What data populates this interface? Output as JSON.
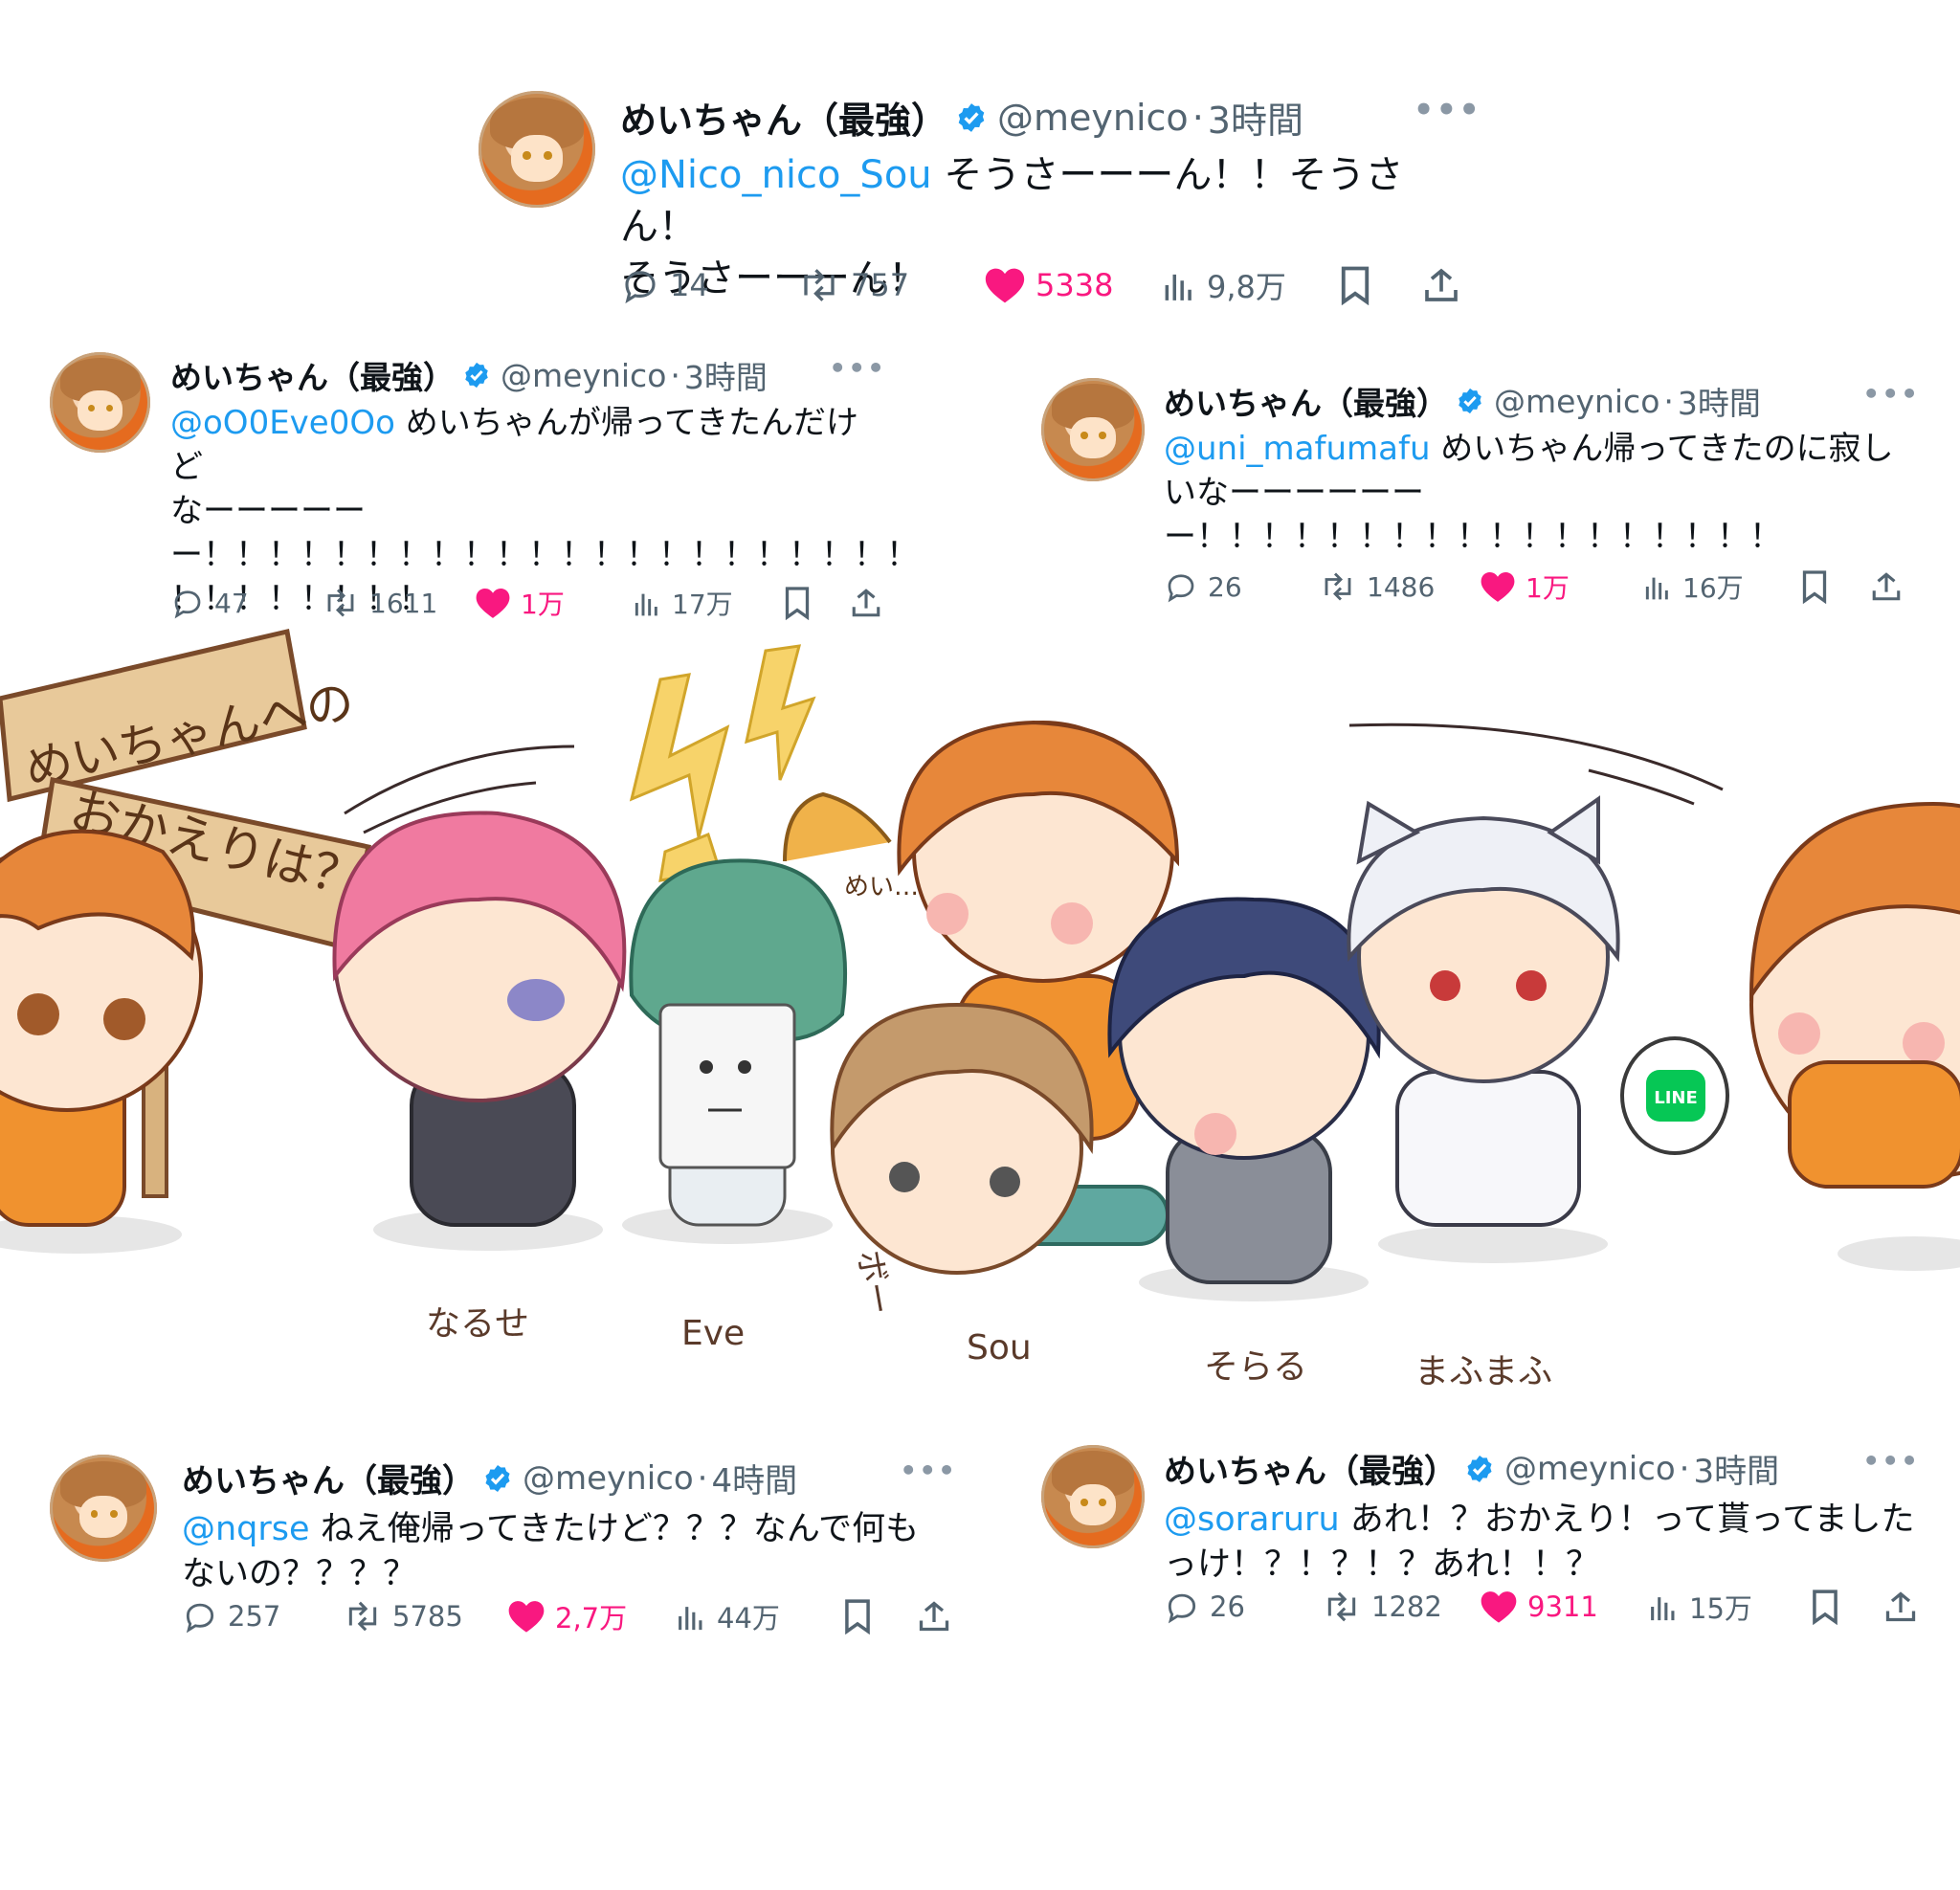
{
  "colors": {
    "link": "#1d9bf0",
    "like": "#f91880",
    "muted": "#536471",
    "verified": "#1d9bf0"
  },
  "tweets": [
    {
      "name": "めいちゃん（最強）",
      "handle": "@meynico",
      "separator": "·",
      "time": "3時間",
      "mention": "@Nico_nico_Sou",
      "text": " そうさーーーん！！そうさん！\nそうさーーーん！",
      "replies": "14",
      "retweets": "757",
      "likes": "5338",
      "views": "9,8万"
    },
    {
      "name": "めいちゃん（最強）",
      "handle": "@meynico",
      "separator": "·",
      "time": "3時間",
      "mention": "@oO0Eve0Oo",
      "text": " めいちゃんが帰ってきたんだけど\nなーーーーー\nー！！！！！！！！！！！！！！！！！！！！！！\n！！！！！！！！",
      "replies": "47",
      "retweets": "1611",
      "likes": "1万",
      "views": "17万"
    },
    {
      "name": "めいちゃん（最強）",
      "handle": "@meynico",
      "separator": "·",
      "time": "3時間",
      "mention": "@uni_mafumafu",
      "text": " めいちゃん帰ってきたのに寂し\nいなーーーーーー\nー！！！！！！！！！！！！！！！！！！",
      "replies": "26",
      "retweets": "1486",
      "likes": "1万",
      "views": "16万"
    },
    {
      "name": "めいちゃん（最強）",
      "handle": "@meynico",
      "separator": "·",
      "time": "4時間",
      "mention": "@nqrse",
      "text": " ねえ俺帰ってきたけど？？？なんで何も\nないの？？？？",
      "replies": "257",
      "retweets": "5785",
      "likes": "2,7万",
      "views": "44万"
    },
    {
      "name": "めいちゃん（最強）",
      "handle": "@meynico",
      "separator": "·",
      "time": "3時間",
      "mention": "@soraruru",
      "text": " あれ！？おかえり！って貰ってました\nっけ！？！？！？あれ！！？",
      "replies": "26",
      "retweets": "1282",
      "likes": "9311",
      "views": "15万"
    }
  ],
  "illustration": {
    "sign_text_1": "めいちゃんへの",
    "sign_text_2": "おかえりは？",
    "hood_label": "めい…",
    "bo_text": "ボー",
    "line_badge": "LINE",
    "characters": [
      "なるせ",
      "Eve",
      "Sou",
      "そらる",
      "まふまふ"
    ]
  }
}
